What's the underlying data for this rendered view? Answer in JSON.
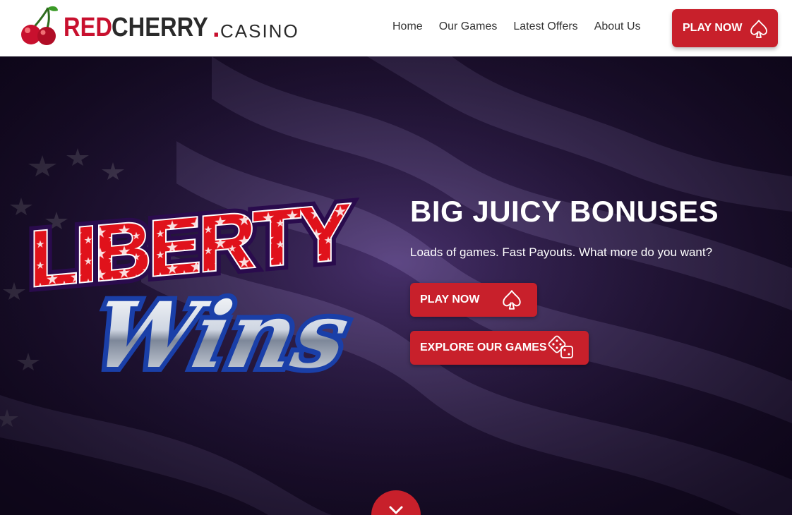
{
  "header": {
    "logo": {
      "red": "RED",
      "cherry": "CHERRY",
      "dot": ".",
      "casino": "CASINO"
    },
    "nav": [
      "Home",
      "Our Games",
      "Latest Offers",
      "About Us"
    ],
    "cta": {
      "label": "PLAY NOW",
      "icon": "spade-icon"
    }
  },
  "hero": {
    "game_logo": {
      "line1": "LIBERTY",
      "line2": "Wins"
    },
    "title": "BIG JUICY BONUSES",
    "subtitle": "Loads of games. Fast Payouts. What more do you want?",
    "buttons": [
      {
        "label": "PLAY NOW",
        "icon": "spade-icon"
      },
      {
        "label": "EXPLORE OUR GAMES",
        "icon": "dice-icon"
      }
    ],
    "scroll_icon": "chevron-down-icon"
  },
  "colors": {
    "brand_red": "#c8202b",
    "logo_red": "#c8102e",
    "header_bg": "#ffffff",
    "hero_bg": "#2c1a47"
  }
}
